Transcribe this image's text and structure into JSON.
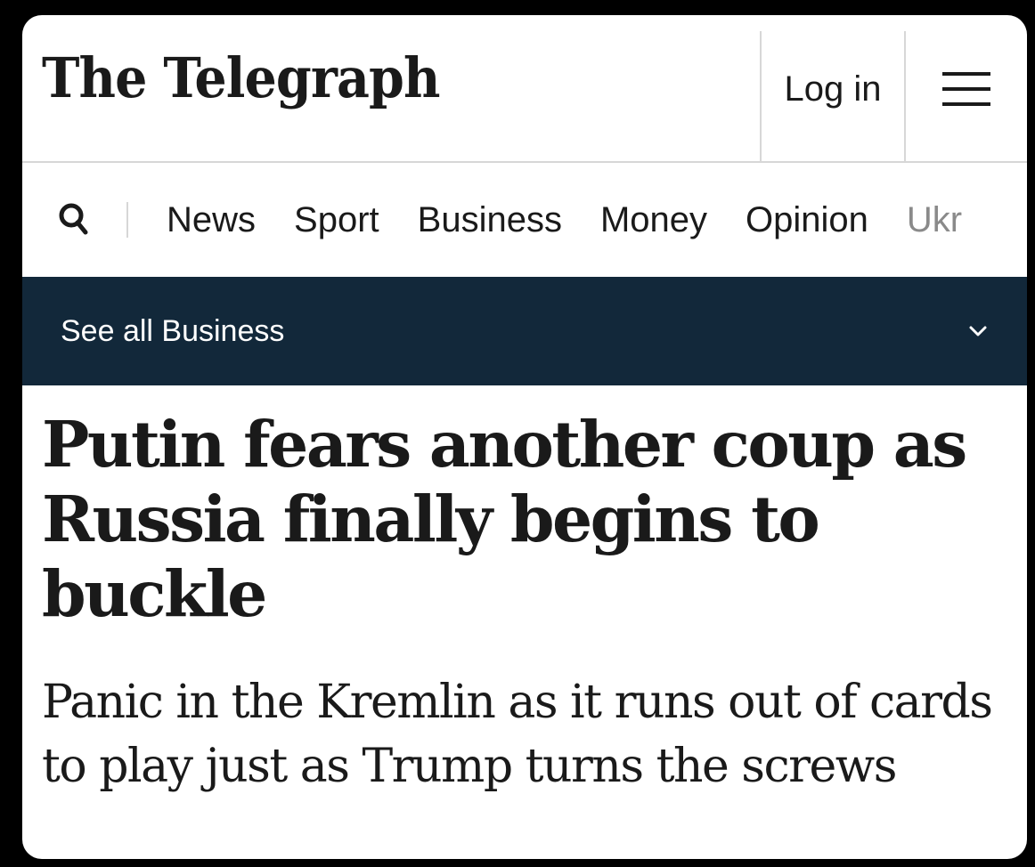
{
  "header": {
    "logo_text": "The Telegraph",
    "login_label": "Log in",
    "menu_icon": "hamburger-menu-icon"
  },
  "nav": {
    "search_icon": "search-icon",
    "items": [
      {
        "label": "News"
      },
      {
        "label": "Sport"
      },
      {
        "label": "Business"
      },
      {
        "label": "Money"
      },
      {
        "label": "Opinion"
      },
      {
        "label": "Ukr"
      }
    ]
  },
  "section_bar": {
    "label": "See all Business",
    "chevron_icon": "chevron-down-icon",
    "background": "#12283a"
  },
  "article": {
    "headline": "Putin fears another coup as Russia finally begins to buckle",
    "standfirst": "Panic in the Kremlin as it runs out of cards to play just as Trump turns the screws"
  }
}
